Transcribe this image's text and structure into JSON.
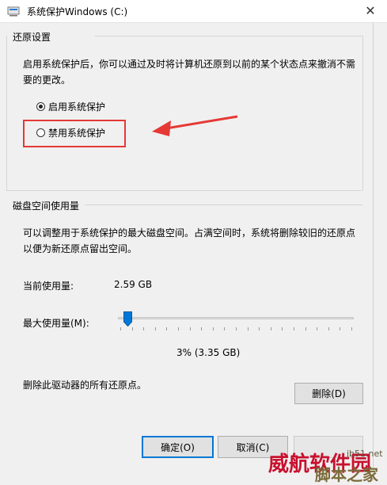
{
  "window": {
    "title": "系统保护Windows (C:)",
    "close_glyph": "✕"
  },
  "restore_settings": {
    "heading": "还原设置",
    "description": "启用系统保护后，你可以通过及时将计算机还原到以前的某个状态点来撤消不需要的更改。",
    "options": [
      {
        "label": "启用系统保护",
        "selected": true
      },
      {
        "label": "禁用系统保护",
        "selected": false
      }
    ]
  },
  "disk_usage": {
    "heading": "磁盘空间使用量",
    "description": "可以调整用于系统保护的最大磁盘空间。占满空间时，系统将删除较旧的还原点以便为新还原点留出空间。",
    "current_label": "当前使用量:",
    "current_value": "2.59 GB",
    "max_label": "最大使用量(M):",
    "slider_percent": 3,
    "slider_readout": "3% (3.35 GB)",
    "delete_text": "删除此驱动器的所有还原点。",
    "delete_button": "删除(D)"
  },
  "footer": {
    "ok_button": "确定(O)",
    "cancel_button": "取消(C)"
  },
  "watermark": {
    "text_1": "脚本之家",
    "text_2": "jb51.net",
    "text_3": "威航软件园"
  },
  "colors": {
    "annotation_red": "#e53935",
    "default_button_border": "#0078d7",
    "slider_thumb": "#0078d7",
    "watermark_1": "#c8102e",
    "watermark_2": "#7a6b3a"
  },
  "icons": {
    "title": "computer-drive-icon",
    "close": "close-icon",
    "annotation": "red-arrow-icon",
    "slider_thumb": "slider-thumb-icon"
  }
}
